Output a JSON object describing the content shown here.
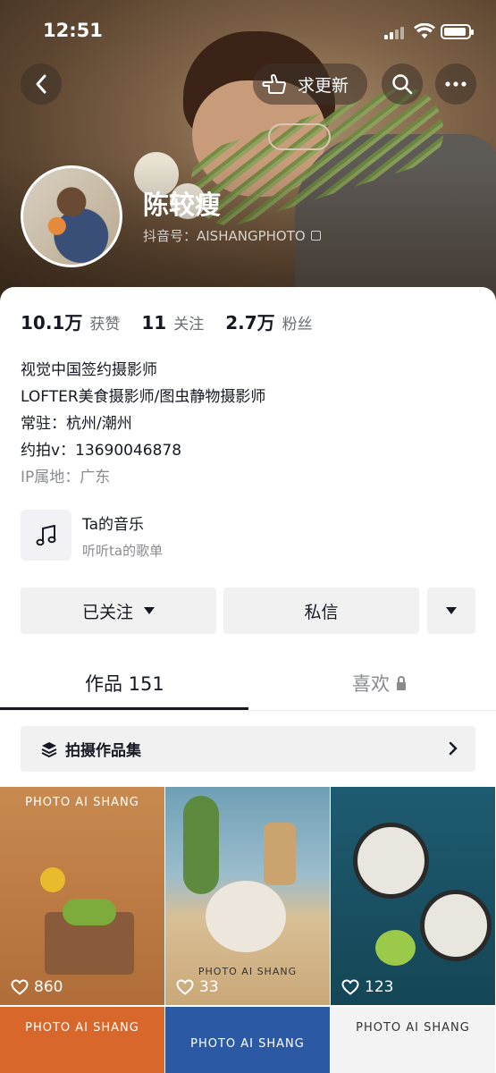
{
  "status_bar": {
    "time": "12:51"
  },
  "header": {
    "update_label": "求更新"
  },
  "profile": {
    "name": "陈较瘦",
    "douyin_id": "抖音号：AISHANGPHOTO"
  },
  "stats": [
    {
      "num": "10.1万",
      "label": "获赞"
    },
    {
      "num": "11",
      "label": "关注"
    },
    {
      "num": "2.7万",
      "label": "粉丝"
    }
  ],
  "bio": {
    "line1": "视觉中国签约摄影师",
    "line2": "LOFTER美食摄影师/图虫静物摄影师",
    "line3": "常驻：杭州/潮州",
    "line4": "约拍v：13690046878",
    "ip": "IP属地：广东"
  },
  "music": {
    "title": "Ta的音乐",
    "subtitle": "听听ta的歌单"
  },
  "actions": {
    "followed": "已关注",
    "message": "私信"
  },
  "tabs": {
    "works": "作品 151",
    "likes": "喜欢"
  },
  "collection": {
    "label": "拍摄作品集"
  },
  "grid": [
    {
      "brand": "PHOTO AI SHANG",
      "likes": "860"
    },
    {
      "brand": "PHOTO AI SHANG",
      "likes": "33"
    },
    {
      "brand": "",
      "likes": "123"
    },
    {
      "brand": "PHOTO AI SHANG",
      "likes": ""
    },
    {
      "brand": "PHOTO AI SHANG",
      "likes": ""
    },
    {
      "brand": "PHOTO AI SHANG",
      "likes": ""
    }
  ],
  "icons": {
    "back": "chevron-left-icon",
    "search": "search-icon",
    "more": "more-icon",
    "music": "music-note-icon",
    "stack": "stack-icon",
    "heart": "heart-icon"
  }
}
